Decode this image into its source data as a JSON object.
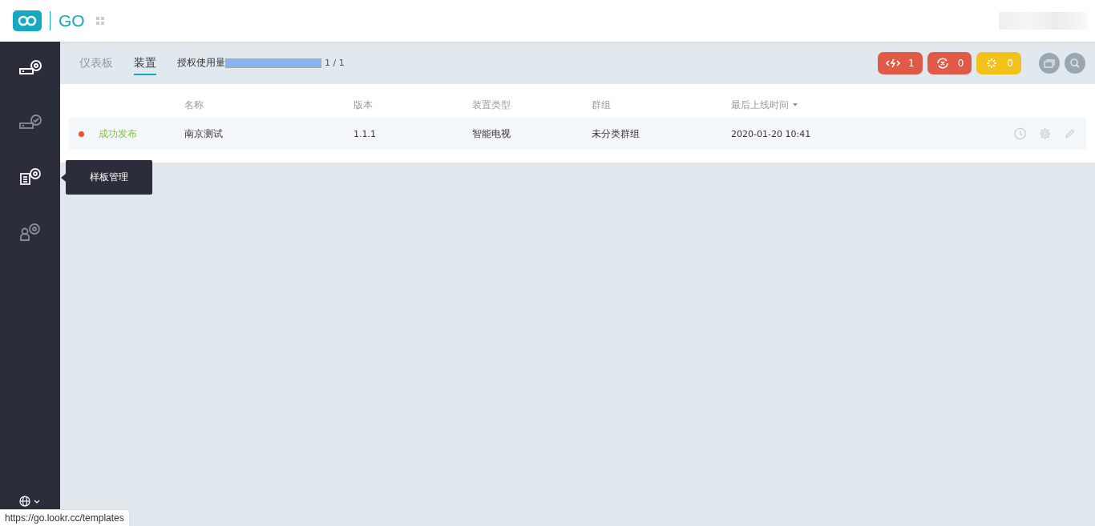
{
  "header": {
    "app_name": "GO"
  },
  "sidebar": {
    "items": [
      {
        "kind": "device",
        "selected": true,
        "hovered": false
      },
      {
        "kind": "device-check",
        "selected": false,
        "hovered": false
      },
      {
        "kind": "template",
        "selected": false,
        "hovered": true,
        "tooltip": "样板管理"
      },
      {
        "kind": "user",
        "selected": false,
        "hovered": false
      }
    ]
  },
  "tabs": [
    {
      "label": "仪表板",
      "selected": false
    },
    {
      "label": "装置",
      "selected": true
    }
  ],
  "license": {
    "label": "授权使用量",
    "level": 1,
    "reading": "1 / 1"
  },
  "badges": [
    {
      "kind": "broken-link",
      "count": "1",
      "color": "#e05a47"
    },
    {
      "kind": "offline",
      "count": "0",
      "color": "#e05a47"
    },
    {
      "kind": "loading",
      "count": "0",
      "color": "#f2c21b"
    }
  ],
  "table": {
    "columns": [
      "名称",
      "版本",
      "装置类型",
      "群组",
      "最后上线时间"
    ],
    "rows": [
      {
        "status": "成功发布",
        "color": "#e8523f",
        "name": "南京测试",
        "version": "1.1.1",
        "type": "智能电视",
        "group": "未分类群组",
        "last_online": "2020-01-20 10:41"
      }
    ]
  },
  "status_bar": {
    "url": "https://go.lookr.cc/templates"
  }
}
